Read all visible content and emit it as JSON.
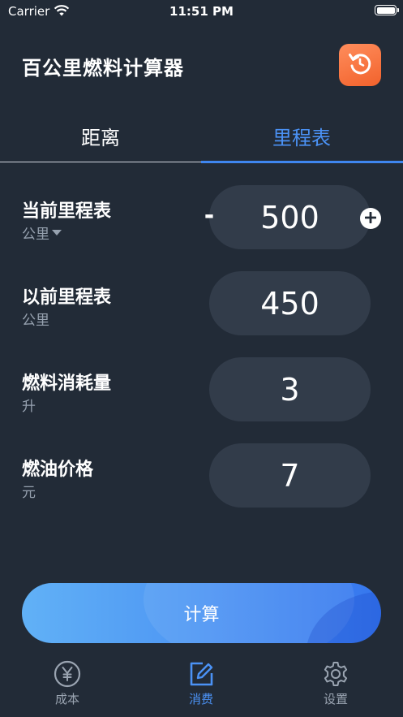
{
  "status_bar": {
    "carrier": "Carrier",
    "time": "11:51 PM"
  },
  "header": {
    "title": "百公里燃料计算器",
    "reset_icon": "reset-icon",
    "reset_color": "#f5733f"
  },
  "tabs": [
    {
      "label": "距离",
      "active": false
    },
    {
      "label": "里程表",
      "active": true
    }
  ],
  "fields": [
    {
      "label": "当前里程表",
      "unit": "公里",
      "value": "500",
      "has_dropdown": true,
      "has_stepper": true
    },
    {
      "label": "以前里程表",
      "unit": "公里",
      "value": "450"
    },
    {
      "label": "燃料消耗量",
      "unit": "升",
      "value": "3"
    },
    {
      "label": "燃油价格",
      "unit": "元",
      "value": "7"
    }
  ],
  "stepper": {
    "minus_label": "-",
    "plus_icon": "plus-circle-icon"
  },
  "calculate_button": {
    "label": "计算"
  },
  "tab_bar": [
    {
      "label": "成本",
      "icon": "yen-circle-icon",
      "active": false
    },
    {
      "label": "消费",
      "icon": "edit-icon",
      "active": true
    },
    {
      "label": "设置",
      "icon": "gear-icon",
      "active": false
    }
  ],
  "colors": {
    "background": "#222b37",
    "accent": "#3f86ef",
    "input_bg": "#323c4a"
  }
}
